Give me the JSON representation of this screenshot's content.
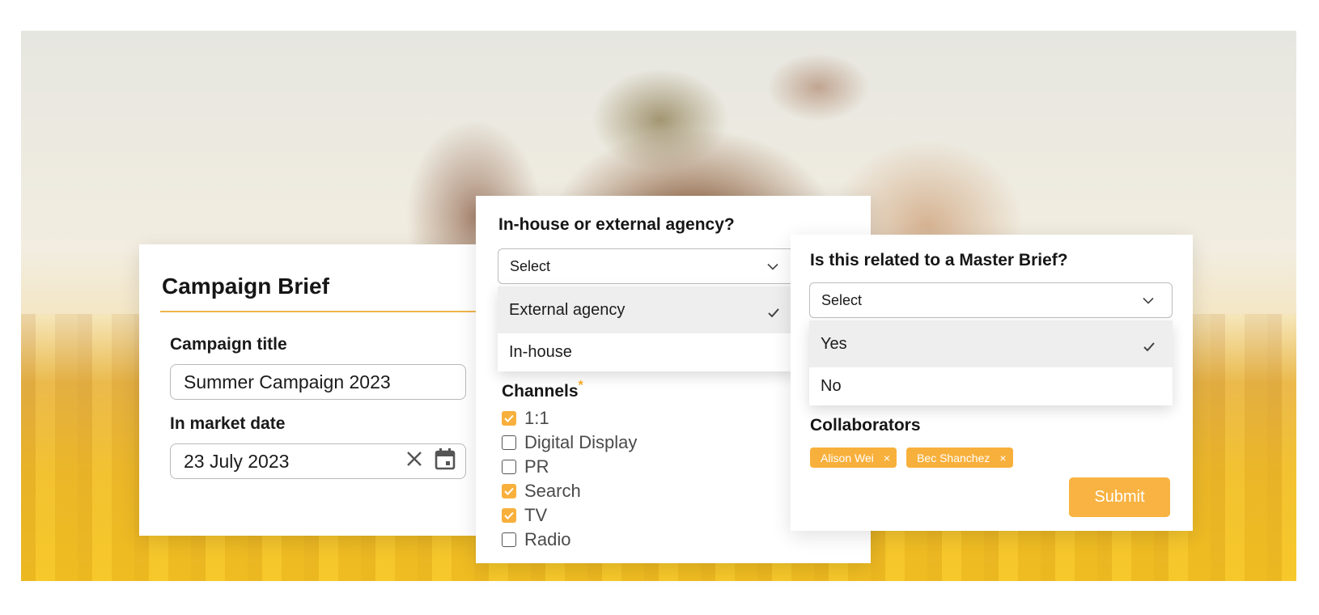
{
  "colors": {
    "accent": "#f8b03c",
    "divider": "#f0b54a",
    "selected_row": "#eeeeee"
  },
  "brief": {
    "title": "Campaign Brief",
    "campaign_title_label": "Campaign title",
    "campaign_title_value": "Summer Campaign 2023",
    "in_market_label": "In market date",
    "in_market_value": "23 July 2023",
    "clear_icon": "close-icon",
    "calendar_icon": "calendar-icon"
  },
  "agency": {
    "question": "In-house or external agency?",
    "select_placeholder": "Select",
    "options": [
      {
        "label": "External agency",
        "selected": true
      },
      {
        "label": "In-house",
        "selected": false
      }
    ],
    "channels_label": "Channels",
    "required_mark": "*",
    "channels": [
      {
        "label": "1:1",
        "checked": true
      },
      {
        "label": "Digital Display",
        "checked": false
      },
      {
        "label": "PR",
        "checked": false
      },
      {
        "label": "Search",
        "checked": true
      },
      {
        "label": "TV",
        "checked": true
      },
      {
        "label": "Radio",
        "checked": false
      }
    ]
  },
  "master": {
    "question": "Is this related to a Master Brief?",
    "select_placeholder": "Select",
    "options": [
      {
        "label": "Yes",
        "selected": true
      },
      {
        "label": "No",
        "selected": false
      }
    ],
    "collaborators_label": "Collaborators",
    "collaborators": [
      "Alison Wei",
      "Bec Shanchez"
    ],
    "chip_remove": "×",
    "submit_label": "Submit"
  }
}
